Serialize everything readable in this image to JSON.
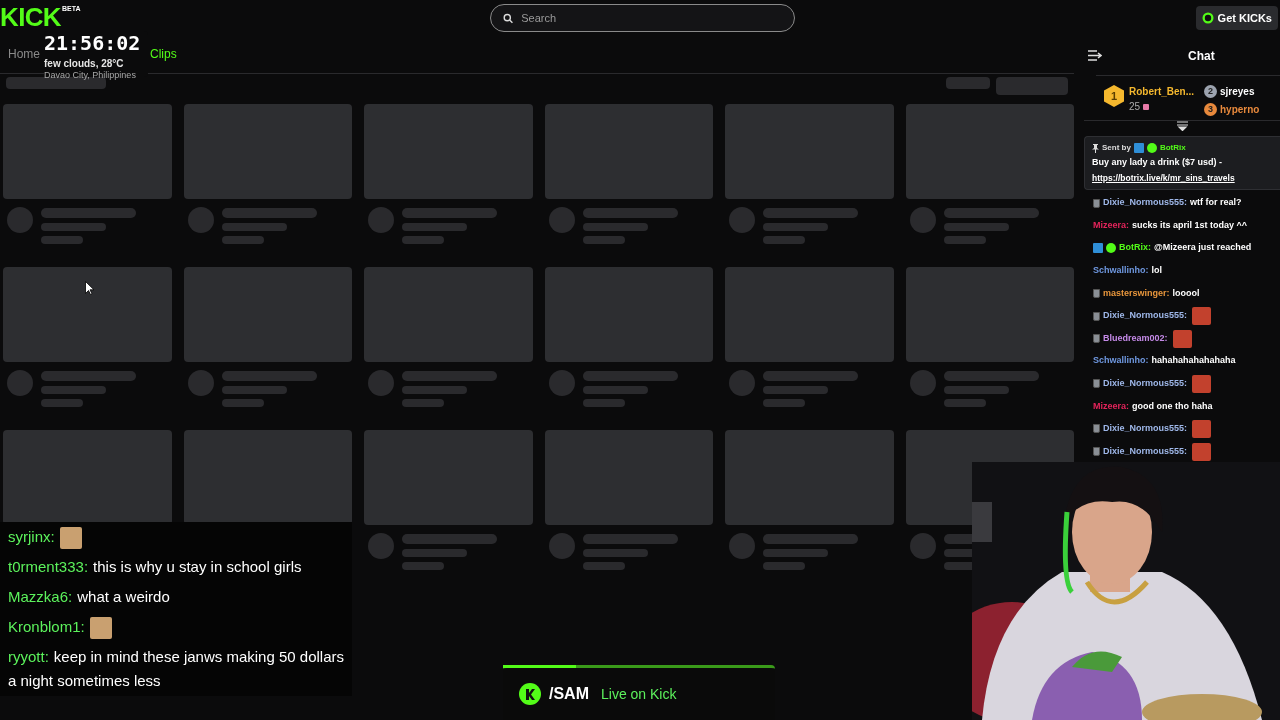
{
  "header": {
    "logo": "KICK",
    "logo_badge": "BETA",
    "search": {
      "placeholder": "Search"
    },
    "get_kicks": "Get KICKs"
  },
  "nav_tabs": [
    {
      "label": "Home",
      "selected": false
    },
    {
      "label": "Clips",
      "selected": true
    }
  ],
  "clock_overlay": {
    "time": "21:56:02",
    "weather": "few clouds, 28°C",
    "location": "Davao City, Philippines"
  },
  "chat": {
    "title": "Chat",
    "leaderboard": [
      {
        "rank": "1",
        "name": "Robert_Ben...",
        "count": "25",
        "color": "#f5b82e"
      },
      {
        "rank": "2",
        "name": "sjreyes",
        "color": "#9ca3af"
      },
      {
        "rank": "3",
        "name": "hyperno",
        "color": "#e8893c"
      }
    ],
    "pinned": {
      "label": "Sent by",
      "sender": "BotRix",
      "text": "Buy any lady a drink ($7 usd) -",
      "link": "https://botrix.live/k/mr_sins_travels"
    },
    "messages": [
      {
        "kind": "cup",
        "user": "Dixie_Normous555:",
        "color": "#9fb8ea",
        "text": "wtf for real?"
      },
      {
        "kind": "plain",
        "user": "Mizeera:",
        "color": "#e3245b",
        "text": "sucks its april 1st today ^^"
      },
      {
        "kind": "bot",
        "user": "BotRix:",
        "color": "#53fc18",
        "text": "@Mizeera just reached"
      },
      {
        "kind": "plain",
        "user": "Schwallinho:",
        "color": "#6f98e0",
        "text": "lol"
      },
      {
        "kind": "cup",
        "user": "masterswinger:",
        "color": "#e8963c",
        "text": "looool"
      },
      {
        "kind": "cup",
        "user": "Dixie_Normous555:",
        "color": "#9fb8ea",
        "emote": true
      },
      {
        "kind": "cup",
        "user": "Bluedream002:",
        "color": "#c58ae8",
        "emote": true
      },
      {
        "kind": "plain",
        "user": "Schwallinho:",
        "color": "#6f98e0",
        "text": "hahahahahahahaha"
      },
      {
        "kind": "cup",
        "user": "Dixie_Normous555:",
        "color": "#9fb8ea",
        "emote": true
      },
      {
        "kind": "plain",
        "user": "Mizeera:",
        "color": "#e3245b",
        "text": "good one tho haha"
      },
      {
        "kind": "cup",
        "user": "Dixie_Normous555:",
        "color": "#9fb8ea",
        "emote": true
      },
      {
        "kind": "cup",
        "user": "Dixie_Normous555:",
        "color": "#9fb8ea",
        "emote": true
      }
    ]
  },
  "stream_chat": [
    {
      "user": "syrjinx:",
      "emote": true
    },
    {
      "user": "t0rment333:",
      "text": "this is why u stay in school girls"
    },
    {
      "user": "Mazzka6:",
      "text": "what a weirdo"
    },
    {
      "user": "Kronblom1:",
      "emote": true
    },
    {
      "user": "ryyott:",
      "text": "keep in mind these janws making 50 dollars a night sometimes less"
    }
  ],
  "live_banner": {
    "name": "/SAM",
    "status": "Live on Kick",
    "level": 0.27
  }
}
